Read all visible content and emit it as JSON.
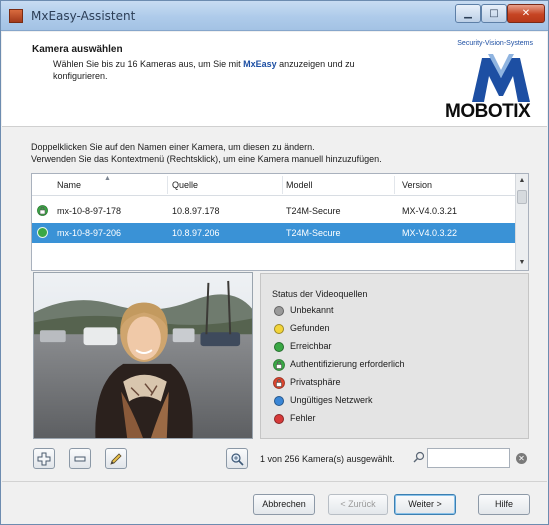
{
  "window": {
    "title": "MxEasy-Assistent",
    "controls": {
      "minimize": "▁",
      "maximize": "□",
      "close": "✕"
    }
  },
  "header": {
    "title": "Kamera auswählen",
    "desc_before": "Wählen Sie bis zu 16 Kameras aus, um Sie mit ",
    "desc_brand": "MxEasy",
    "desc_after": " anzuzeigen und zu konfigurieren.",
    "logo_tagline": "Security-Vision-Systems",
    "logo_text": "MOBOTIX"
  },
  "instructions": {
    "line1": "Doppelklicken Sie auf den Namen einer Kamera, um diesen zu ändern.",
    "line2": "Verwenden Sie das Kontextmenü (Rechtsklick), um eine Kamera manuell hinzuzufügen."
  },
  "camera_list": {
    "columns": [
      "Name",
      "Quelle",
      "Modell",
      "Version"
    ],
    "rows": [
      {
        "name": "mx-10-8-97-178",
        "source": "10.8.97.178",
        "model": "T24M-Secure",
        "version": "MX-V4.0.3.21",
        "status": "Authentifizierung erforderlich",
        "selected": false
      },
      {
        "name": "mx-10-8-97-206",
        "source": "10.8.97.206",
        "model": "T24M-Secure",
        "version": "MX-V4.0.3.22",
        "status": "Erreichbar",
        "selected": true
      }
    ]
  },
  "status_legend": {
    "title": "Status der Videoquellen",
    "items": [
      {
        "label": "Unbekannt",
        "color": "#9a9a9a",
        "icon": "gray-dot-icon"
      },
      {
        "label": "Gefunden",
        "color": "#f2d43a",
        "icon": "yellow-dot-icon"
      },
      {
        "label": "Erreichbar",
        "color": "#3aa845",
        "icon": "green-dot-icon"
      },
      {
        "label": "Authentifizierung erforderlich",
        "color": "#3aa845",
        "icon": "green-lock-icon"
      },
      {
        "label": "Privatsphäre",
        "color": "#d9452f",
        "icon": "privacy-lock-icon"
      },
      {
        "label": "Ungültiges Netzwerk",
        "color": "#3a86d6",
        "icon": "blue-dot-icon"
      },
      {
        "label": "Fehler",
        "color": "#d63a3a",
        "icon": "red-dot-icon"
      }
    ]
  },
  "toolbar": {
    "add_icon": "plus-icon",
    "remove_icon": "minus-icon",
    "edit_icon": "pencil-icon",
    "search_network_icon": "network-search-icon",
    "selection_text": "1 von 256 Kamera(s) ausgewählt.",
    "search_value": "",
    "clear_icon": "clear-icon"
  },
  "buttons": {
    "cancel": "Abbrechen",
    "back": "< Zurück",
    "next": "Weiter >",
    "help": "Hilfe"
  },
  "colors": {
    "selection": "#3a92d6",
    "brand_blue": "#1d4fa3"
  }
}
